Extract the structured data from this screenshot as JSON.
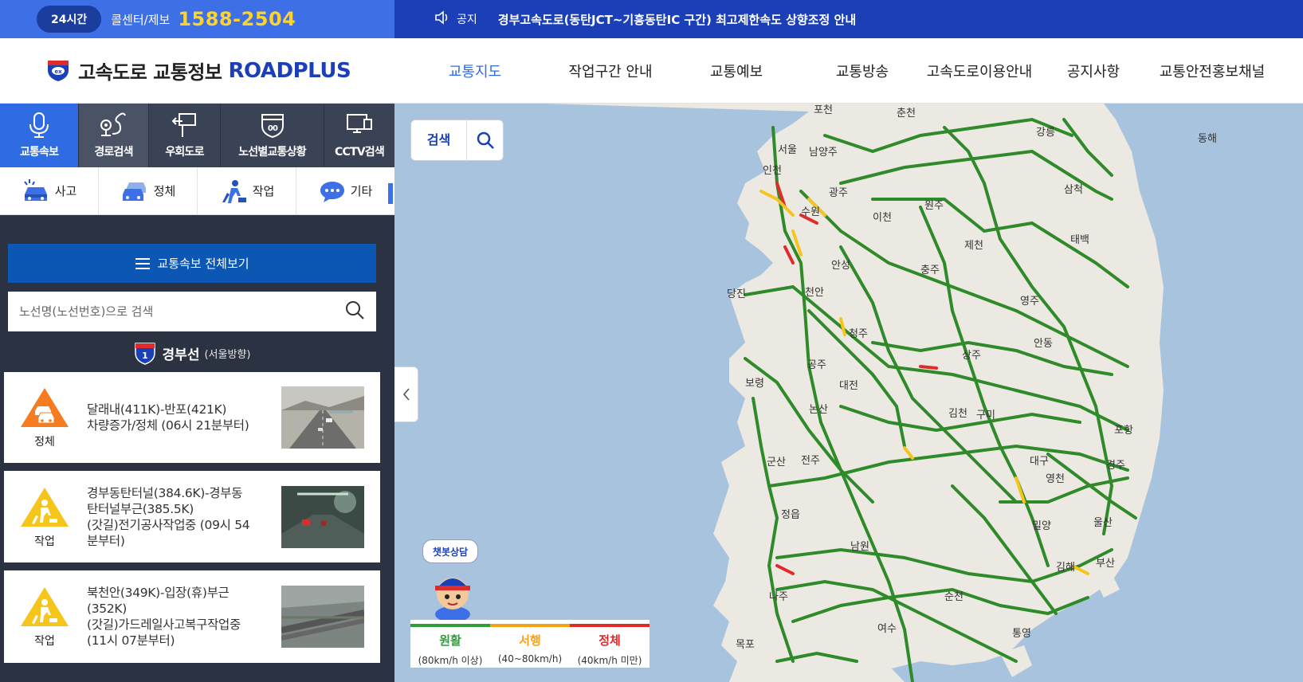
{
  "topbar": {
    "badge_24": "24시간",
    "callcenter_label": "콜센터/제보",
    "callcenter_number": "1588-2504",
    "notice_label": "공지",
    "notice_text": "경부고속도로(동탄JCT~기흥동탄IC 구간) 최고제한속도 상향조정 안내"
  },
  "header": {
    "logo_text": "고속도로 교통정보",
    "logo_brand": "ROADPLUS",
    "nav": [
      "교통지도",
      "작업구간 안내",
      "교통예보",
      "교통방송",
      "고속도로이용안내",
      "공지사항",
      "교통안전홍보채널"
    ],
    "active_nav": "교통지도"
  },
  "sidebar": {
    "tabs": [
      "교통속보",
      "경로검색",
      "우회도로",
      "노선별교통상황",
      "CCTV검색"
    ],
    "filters": [
      "사고",
      "정체",
      "작업",
      "기타"
    ],
    "all_button": "교통속보 전체보기",
    "search_placeholder": "노선명(노선번호)으로 검색",
    "route": {
      "number": "1",
      "name": "경부선",
      "direction": "(서울방향)"
    },
    "cards": [
      {
        "type": "정체",
        "lines": [
          "달래내(411K)-반포(421K)",
          "차량증가/정체 (06시 21분부터)"
        ]
      },
      {
        "type": "작업",
        "lines": [
          "경부동탄터널(384.6K)-경부동",
          "탄터널부근(385.5K)",
          "(갓길)전기공사작업중 (09시 54",
          "분부터)"
        ]
      },
      {
        "type": "작업",
        "lines": [
          "북천안(349K)-입장(휴)부근",
          "(352K)",
          "(갓길)가드레일사고복구작업중",
          "(11시 07분부터)"
        ]
      }
    ]
  },
  "map": {
    "search_label": "검색",
    "chat_label": "챗봇상담",
    "legend": [
      {
        "label": "원활",
        "sub": "(80km/h 이상)",
        "color": "#2e9d3a"
      },
      {
        "label": "서행",
        "sub": "(40~80km/h)",
        "color": "#f5a21b"
      },
      {
        "label": "정체",
        "sub": "(40km/h 미만)",
        "color": "#e02b2b"
      }
    ],
    "places": [
      "포천",
      "춘천",
      "강릉",
      "동해",
      "서울",
      "남양주",
      "인천",
      "광주",
      "삼척",
      "원주",
      "이천",
      "수원",
      "태백",
      "제천",
      "안성",
      "충주",
      "당진",
      "천안",
      "영주",
      "청주",
      "안동",
      "상주",
      "공주",
      "보령",
      "대전",
      "김천",
      "구미",
      "논산",
      "포항",
      "군산",
      "전주",
      "경주",
      "대구",
      "영천",
      "정읍",
      "울산",
      "밀양",
      "남원",
      "김해",
      "부산",
      "나주",
      "순천",
      "여수",
      "통영",
      "목포"
    ]
  }
}
